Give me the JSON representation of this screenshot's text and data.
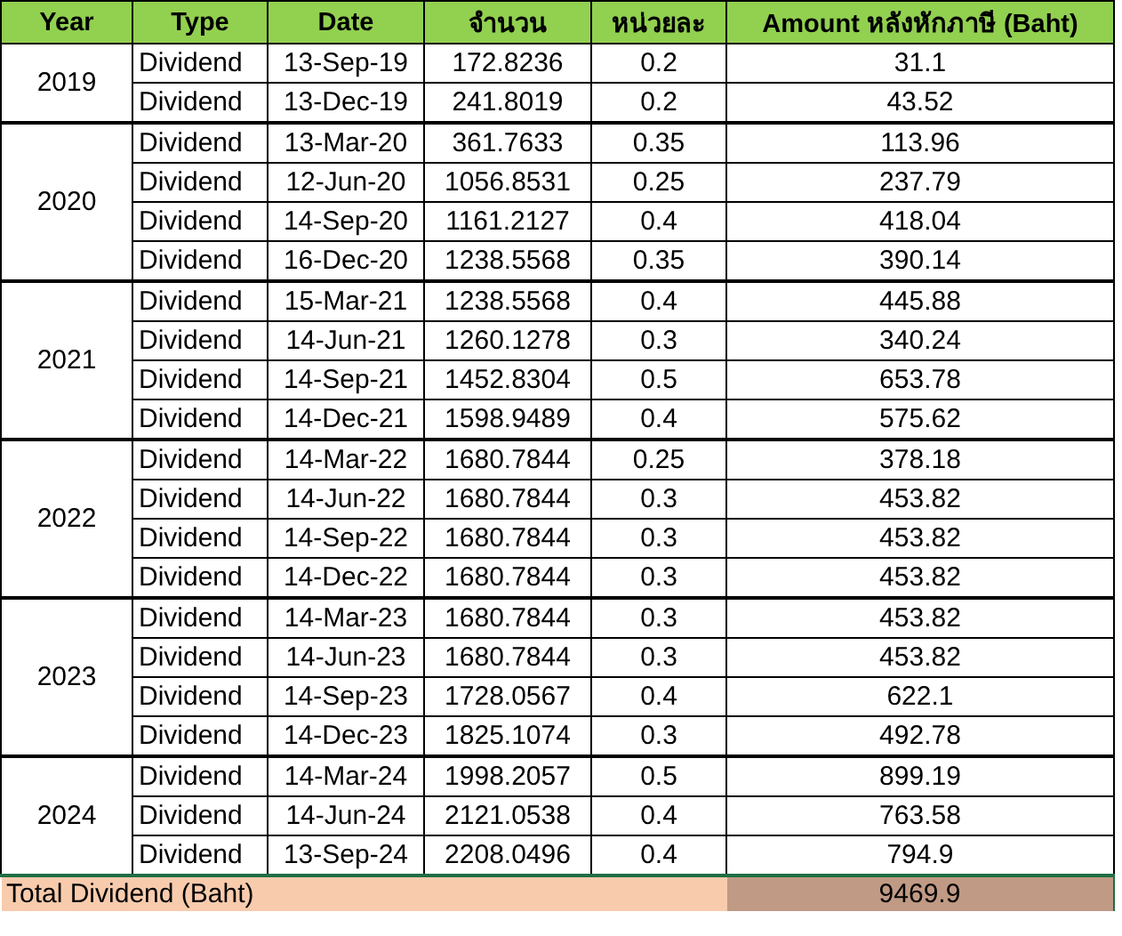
{
  "columns": [
    "Year",
    "Type",
    "Date",
    "จำนวน",
    "หน่วยละ",
    "Amount หลังหักภาษี (Baht)"
  ],
  "groups": [
    {
      "year": "2019",
      "rows": [
        [
          "Dividend",
          "13-Sep-19",
          "172.8236",
          "0.2",
          "31.1"
        ],
        [
          "Dividend",
          "13-Dec-19",
          "241.8019",
          "0.2",
          "43.52"
        ]
      ]
    },
    {
      "year": "2020",
      "rows": [
        [
          "Dividend",
          "13-Mar-20",
          "361.7633",
          "0.35",
          "113.96"
        ],
        [
          "Dividend",
          "12-Jun-20",
          "1056.8531",
          "0.25",
          "237.79"
        ],
        [
          "Dividend",
          "14-Sep-20",
          "1161.2127",
          "0.4",
          "418.04"
        ],
        [
          "Dividend",
          "16-Dec-20",
          "1238.5568",
          "0.35",
          "390.14"
        ]
      ]
    },
    {
      "year": "2021",
      "rows": [
        [
          "Dividend",
          "15-Mar-21",
          "1238.5568",
          "0.4",
          "445.88"
        ],
        [
          "Dividend",
          "14-Jun-21",
          "1260.1278",
          "0.3",
          "340.24"
        ],
        [
          "Dividend",
          "14-Sep-21",
          "1452.8304",
          "0.5",
          "653.78"
        ],
        [
          "Dividend",
          "14-Dec-21",
          "1598.9489",
          "0.4",
          "575.62"
        ]
      ]
    },
    {
      "year": "2022",
      "rows": [
        [
          "Dividend",
          "14-Mar-22",
          "1680.7844",
          "0.25",
          "378.18"
        ],
        [
          "Dividend",
          "14-Jun-22",
          "1680.7844",
          "0.3",
          "453.82"
        ],
        [
          "Dividend",
          "14-Sep-22",
          "1680.7844",
          "0.3",
          "453.82"
        ],
        [
          "Dividend",
          "14-Dec-22",
          "1680.7844",
          "0.3",
          "453.82"
        ]
      ]
    },
    {
      "year": "2023",
      "rows": [
        [
          "Dividend",
          "14-Mar-23",
          "1680.7844",
          "0.3",
          "453.82"
        ],
        [
          "Dividend",
          "14-Jun-23",
          "1680.7844",
          "0.3",
          "453.82"
        ],
        [
          "Dividend",
          "14-Sep-23",
          "1728.0567",
          "0.4",
          "622.1"
        ],
        [
          "Dividend",
          "14-Dec-23",
          "1825.1074",
          "0.3",
          "492.78"
        ]
      ]
    },
    {
      "year": "2024",
      "rows": [
        [
          "Dividend",
          "14-Mar-24",
          "1998.2057",
          "0.5",
          "899.19"
        ],
        [
          "Dividend",
          "14-Jun-24",
          "2121.0538",
          "0.4",
          "763.58"
        ],
        [
          "Dividend",
          "13-Sep-24",
          "2208.0496",
          "0.4",
          "794.9"
        ]
      ]
    }
  ],
  "total": {
    "label": "Total Dividend (Baht)",
    "value": "9469.9"
  }
}
